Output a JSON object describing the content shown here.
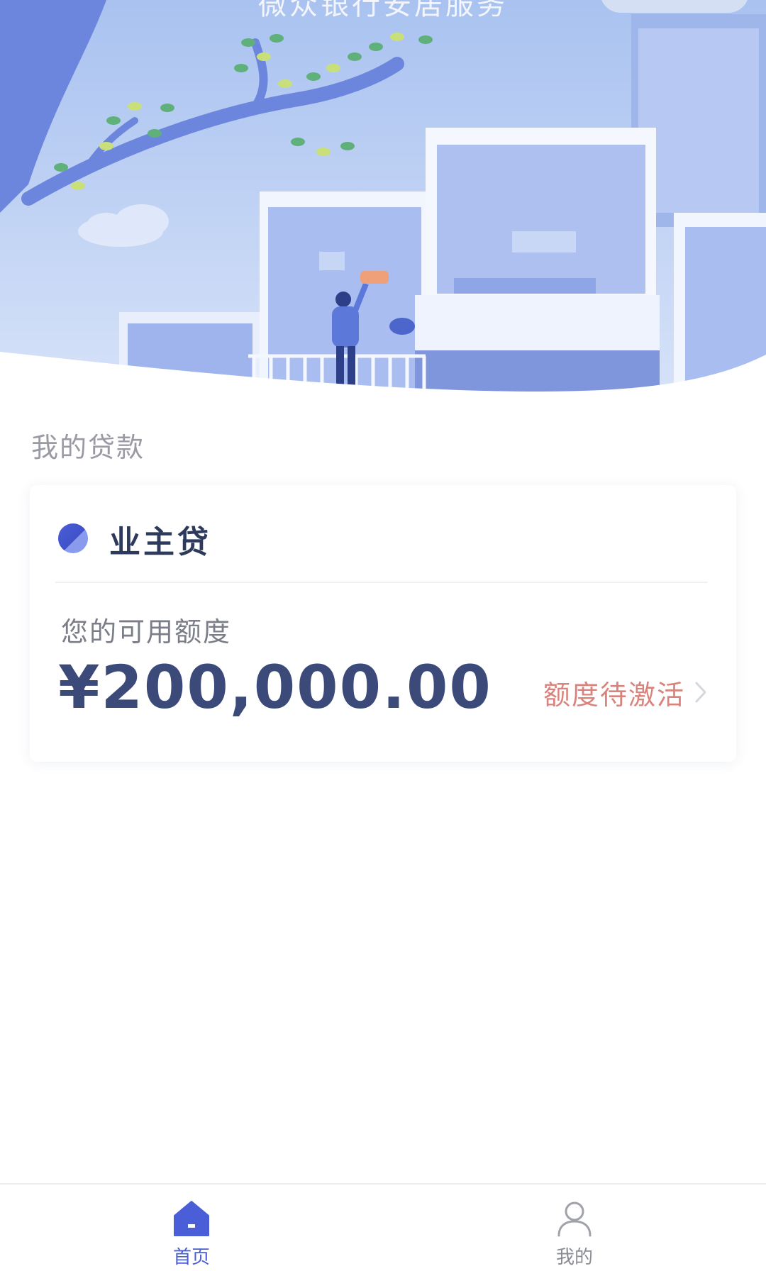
{
  "header": {
    "title": "微众银行安居服务"
  },
  "section": {
    "title": "我的贷款"
  },
  "loan_card": {
    "product_name": "业主贷",
    "limit_label": "您的可用额度",
    "limit_amount": "¥200,000.00",
    "activate_label": "额度待激活"
  },
  "bottom_nav": {
    "items": [
      {
        "label": "首页",
        "icon": "home-icon",
        "active": true
      },
      {
        "label": "我的",
        "icon": "user-icon",
        "active": false
      }
    ]
  },
  "colors": {
    "accent": "#4a5ed8",
    "amount_text": "#3b4a79",
    "activate_text": "#d9837c",
    "hero_sky": "#b9cdf4"
  }
}
